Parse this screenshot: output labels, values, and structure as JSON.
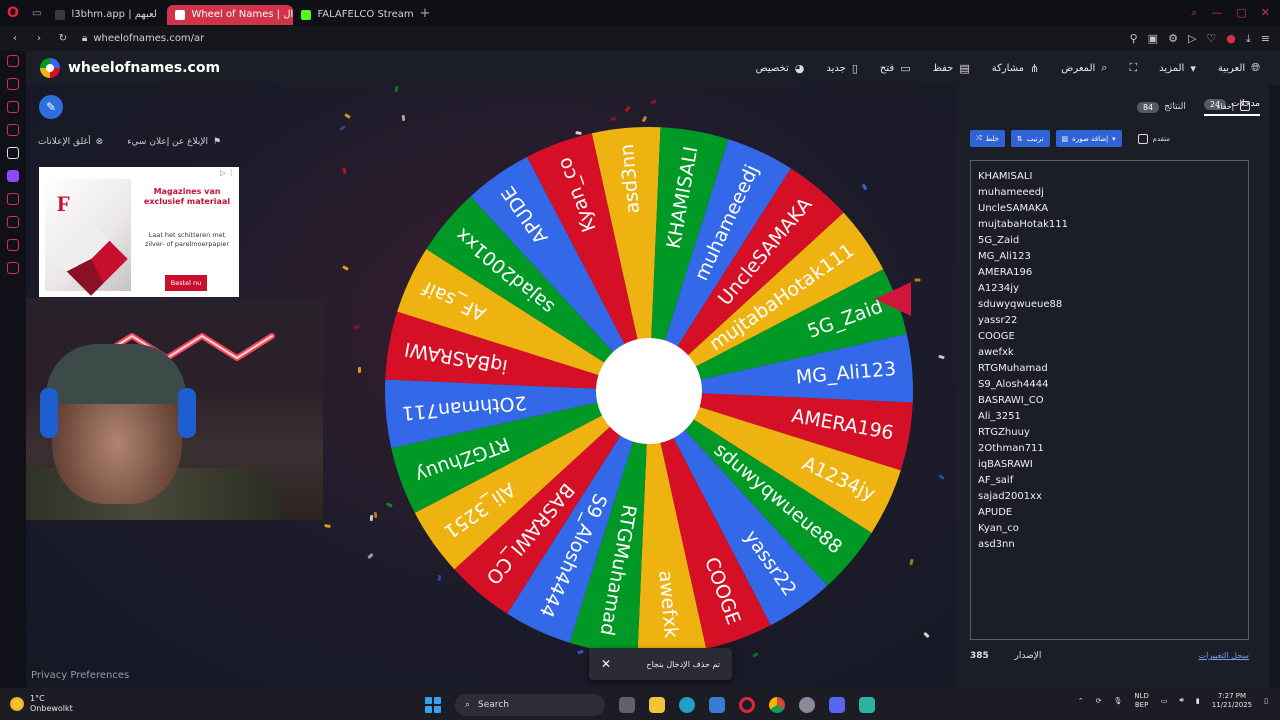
{
  "browser": {
    "tabs": [
      {
        "title": "l3bhm.app | لعبهم",
        "active": false,
        "favicon_color": "#3a3a3a"
      },
      {
        "title": "Wheel of Names | ال",
        "active": true,
        "favicon_color": "#d0334a"
      },
      {
        "title": "FALAFELCO Stream - Wa",
        "active": false,
        "favicon_color": "#53fc18"
      }
    ],
    "url": "wheelofnames.com/ar"
  },
  "site": {
    "brand": "wheelofnames.com",
    "menu": [
      {
        "label": "تخصيص",
        "icon": "palette-icon"
      },
      {
        "label": "جديد",
        "icon": "new-file-icon"
      },
      {
        "label": "فتح",
        "icon": "folder-icon"
      },
      {
        "label": "حفظ",
        "icon": "save-icon"
      },
      {
        "label": "مشاركة",
        "icon": "share-icon"
      },
      {
        "label": "المعرض",
        "icon": "gallery-search-icon"
      },
      {
        "label": "",
        "icon": "fullscreen-icon"
      },
      {
        "label": "المزيد",
        "icon": "caret-down-icon"
      },
      {
        "label": "العربية",
        "icon": "globe-icon"
      }
    ]
  },
  "ads": {
    "report_label": "الإبلاغ عن إعلان سيء",
    "close_label": "أغلق الإعلانات",
    "ad_title": "Magazines van exclusief materiaal",
    "ad_sub": "Laat het schitteren met zilver- of parelmoerpapier",
    "ad_button": "Bestel nu"
  },
  "privacy": "Privacy Preferences",
  "toast": {
    "message": "تم حذف الإدخال بنجاح"
  },
  "panel": {
    "tabs": [
      {
        "label": "مدخلات",
        "count": "24",
        "active": true
      },
      {
        "label": "النتائج",
        "count": "84",
        "active": false
      }
    ],
    "hide_label": "إخفاء",
    "toolbar": {
      "shuffle": "خلط",
      "sort": "ترتيب",
      "add_image": "إضافة صورة",
      "advanced": "متقدم"
    },
    "entries": [
      "KHAMISALI",
      "muhameeedj",
      "UncleSAMAKA",
      "mujtabaHotak111",
      "5G_Zaid",
      "MG_Ali123",
      "AMERA196",
      "A1234jy",
      "sduwyqwueue88",
      "yassr22",
      "COOGE",
      "awefxk",
      "RTGMuhamad",
      "S9_Alosh4444",
      "BASRAWI_CO",
      "Ali_3251",
      "RTGZhuuy",
      "2Othman711",
      "iqBASRAWI",
      "AF_saif",
      "sajad2001xx",
      "APUDE",
      "Kyan_co",
      "asd3nn"
    ],
    "version_label": "الإصدار",
    "version": "385",
    "changelog": "سجل التغييرات"
  },
  "wheel": {
    "colors": [
      "#3369e8",
      "#d50f25",
      "#eeb211",
      "#009925"
    ],
    "pointer_color": "#d0163a",
    "slices": [
      "MG_Ali123",
      "AMERA196",
      "A1234jy",
      "sduwyqwueue88",
      "yassr22",
      "COOGE",
      "awefxk",
      "RTGMuhamad",
      "S9_Alosh4444",
      "BASRAWI_CO",
      "Ali_3251",
      "RTGZhuuy",
      "2Othman711",
      "iqBASRAWI",
      "AF_saif",
      "sajad2001xx",
      "APUDE",
      "Kyan_co",
      "asd3nn",
      "KHAMISALI",
      "muhameeedj",
      "UncleSAMAKA",
      "mujtabaHotak111",
      "5G_Zaid"
    ]
  },
  "taskbar": {
    "temp": "1°C",
    "weather": "Onbewolkt",
    "search": "Search",
    "lang_top": "NLD",
    "lang_bottom": "BEP",
    "time": "7:27 PM",
    "date": "11/21/2025"
  }
}
